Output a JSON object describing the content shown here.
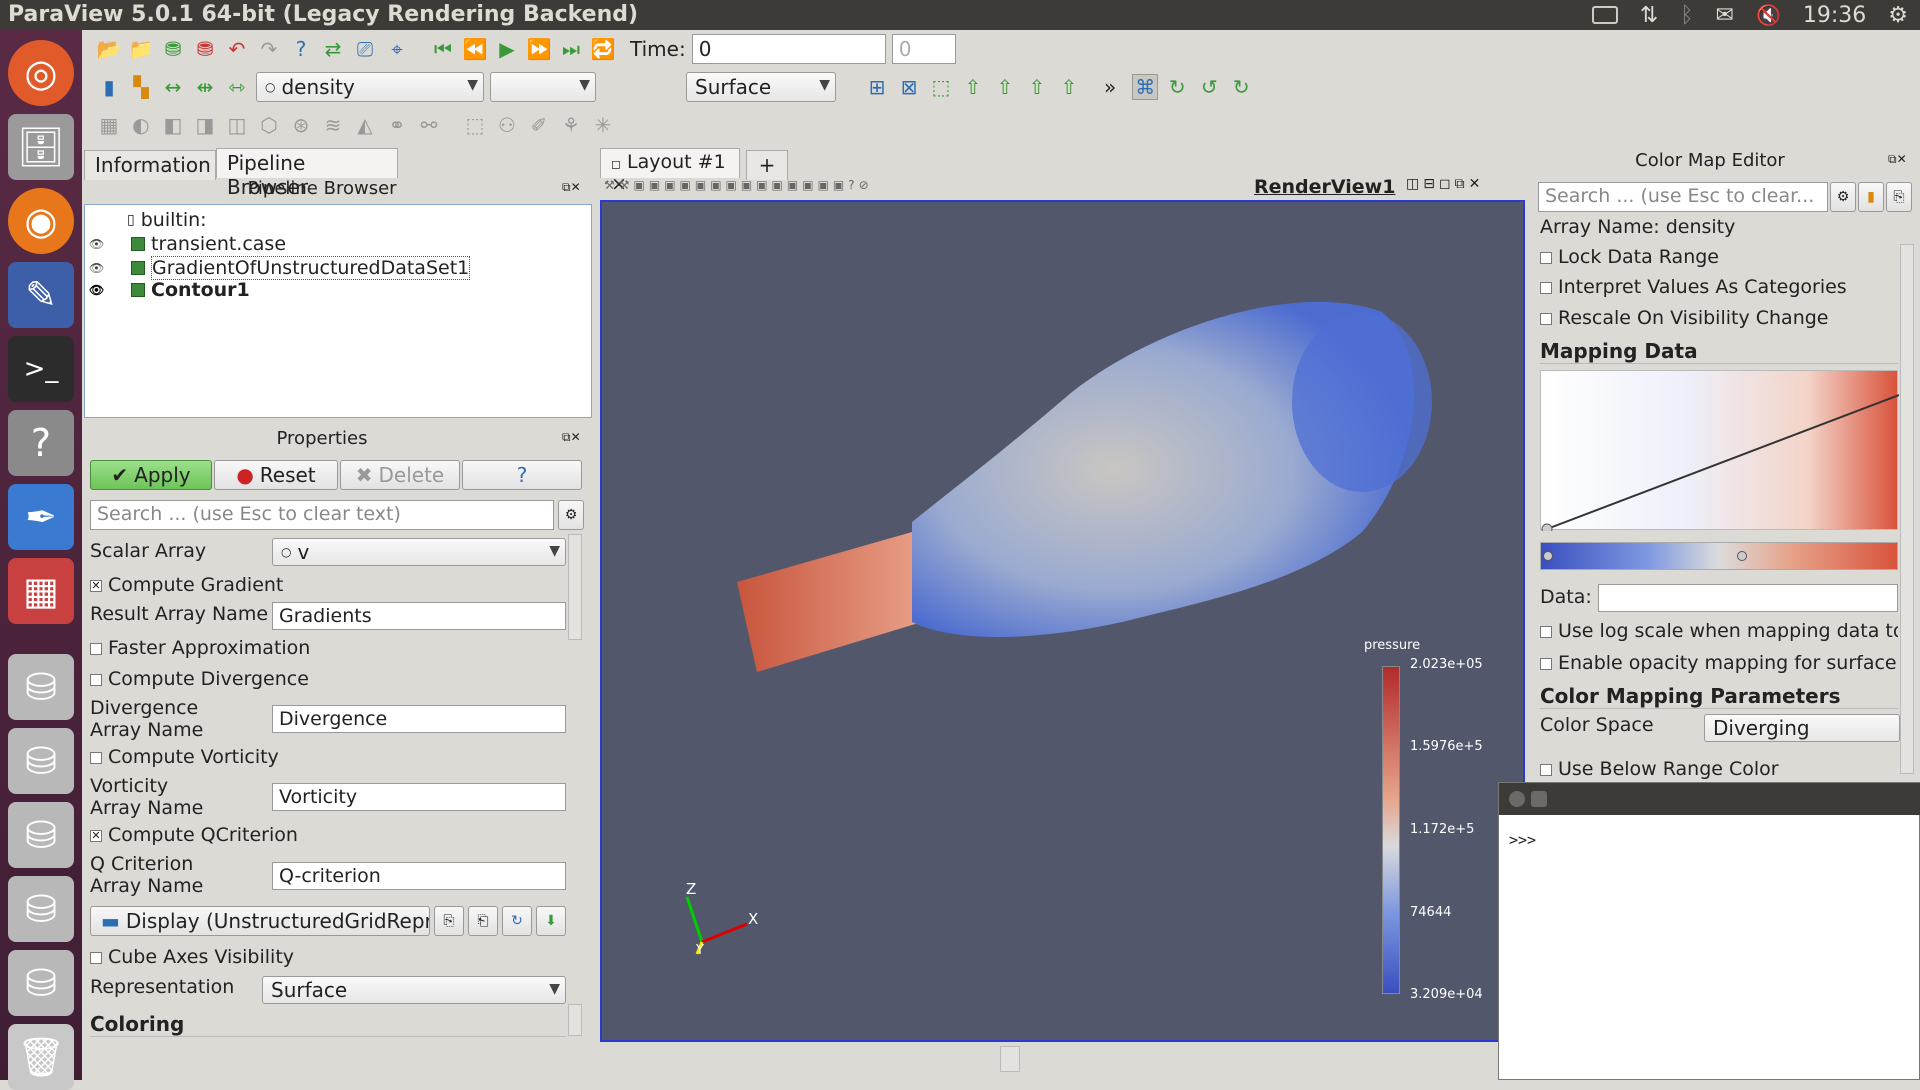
{
  "window": {
    "title": "ParaView 5.0.1 64-bit (Legacy Rendering Backend)",
    "clock": "19:36"
  },
  "toolbar": {
    "time_label": "Time:",
    "time_value": "0",
    "time_index": "0",
    "color_array": "density",
    "component": "",
    "representation": "Surface",
    "more": "»"
  },
  "tabs": {
    "info": "Information",
    "pipeline": "Pipeline Browser",
    "layout": "Layout #1",
    "layout_close": "×",
    "add": "+"
  },
  "pipeline": {
    "header": "Pipeline Browser",
    "items": [
      {
        "label": "builtin:"
      },
      {
        "label": "transient.case"
      },
      {
        "label": "GradientOfUnstructuredDataSet1"
      },
      {
        "label": "Contour1"
      }
    ]
  },
  "properties": {
    "header": "Properties",
    "apply": "Apply",
    "reset": "Reset",
    "delete": "Delete",
    "help": "?",
    "search_placeholder": "Search ... (use Esc to clear text)",
    "scalar_array_label": "Scalar Array",
    "scalar_array_value": "v",
    "compute_gradient": "Compute Gradient",
    "result_array_label": "Result Array Name",
    "result_array_value": "Gradients",
    "faster_approx": "Faster Approximation",
    "compute_divergence": "Compute Divergence",
    "divergence_label_1": "Divergence",
    "divergence_label_2": "Array Name",
    "divergence_value": "Divergence",
    "compute_vorticity": "Compute Vorticity",
    "vorticity_label_1": "Vorticity",
    "vorticity_label_2": "Array Name",
    "vorticity_value": "Vorticity",
    "compute_q": "Compute QCriterion",
    "q_label_1": "Q Criterion",
    "q_label_2": "Array Name",
    "q_value": "Q-criterion",
    "display": "Display (UnstructuredGridRepre",
    "cube_axes": "Cube Axes Visibility",
    "representation_label": "Representation",
    "representation_value": "Surface",
    "coloring": "Coloring"
  },
  "renderview": {
    "title": "RenderView1",
    "colorbar": {
      "title": "pressure",
      "ticks": [
        "2.023e+05",
        "1.5976e+5",
        "1.172e+5",
        "74644",
        "3.209e+04"
      ]
    },
    "axes": {
      "z": "Z",
      "x": "X",
      "y": "Y"
    }
  },
  "colormap": {
    "header": "Color Map Editor",
    "search_placeholder": "Search ... (use Esc to clear...",
    "array_name": "Array Name: density",
    "lock": "Lock Data Range",
    "interpret": "Interpret Values As Categories",
    "rescale": "Rescale On Visibility Change",
    "mapping_data": "Mapping Data",
    "data_label": "Data:",
    "log_scale": "Use log scale when mapping data to",
    "opacity": "Enable opacity mapping for surface",
    "params": "Color Mapping Parameters",
    "color_space_label": "Color Space",
    "color_space_value": "Diverging",
    "below_range": "Use Below Range Color"
  },
  "python": {
    "prompt": ">>>"
  },
  "colors": {
    "accent": "#2a3ad0",
    "view_bg": "#52576b",
    "launcher": "#4a2338"
  }
}
